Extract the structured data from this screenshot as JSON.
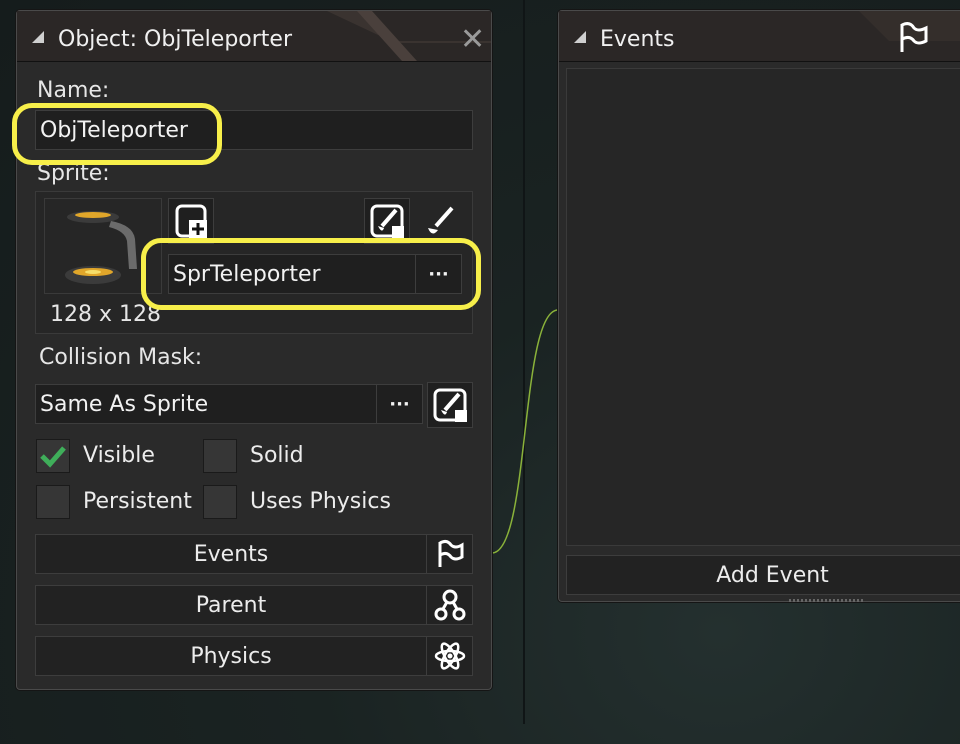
{
  "object_window": {
    "title": "Object: ObjTeleporter",
    "name_label": "Name:",
    "name_value": "ObjTeleporter",
    "sprite_label": "Sprite:",
    "sprite_name": "SprTeleporter",
    "sprite_size": "128 x 128",
    "sprite_more": "···",
    "collision_label": "Collision Mask:",
    "collision_value": "Same As Sprite",
    "collision_more": "···",
    "checkboxes": [
      {
        "label": "Visible",
        "checked": true
      },
      {
        "label": "Solid",
        "checked": false
      },
      {
        "label": "Persistent",
        "checked": false
      },
      {
        "label": "Uses Physics",
        "checked": false
      }
    ],
    "buttons": {
      "events": "Events",
      "parent": "Parent",
      "physics": "Physics"
    }
  },
  "events_window": {
    "title": "Events",
    "add_event": "Add Event"
  },
  "colors": {
    "highlight": "#f7ef4a",
    "check": "#3fae5a",
    "link_curve": "#8ab23a"
  }
}
